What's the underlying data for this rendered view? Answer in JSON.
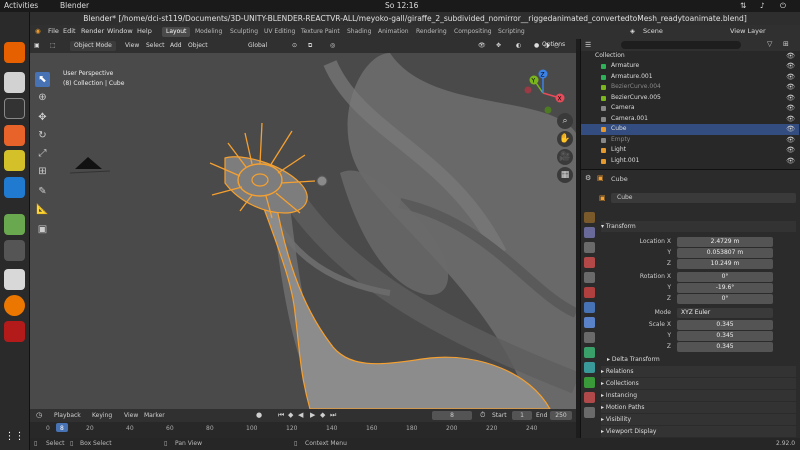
{
  "os_topbar": {
    "activities": "Activities",
    "app": "Blender",
    "clock": "So 12:16"
  },
  "title": "Blender* [/home/dci-st119/Documents/3D-UNITY-BLENDER-REACTVR-ALL/meyoko-gall/giraffe_2_subdivided_nomirror__riggedanimated_convertedtoMesh_readytoanimate.blend]",
  "menu": [
    "File",
    "Edit",
    "Render",
    "Window",
    "Help"
  ],
  "workspaces": [
    "Layout",
    "Modeling",
    "Sculpting",
    "UV Editing",
    "Texture Paint",
    "Shading",
    "Animation",
    "Rendering",
    "Compositing",
    "Scripting"
  ],
  "scene": "Scene",
  "view_layer": "View Layer",
  "viewport_header": {
    "mode": "Object Mode",
    "view": "View",
    "select": "Select",
    "add": "Add",
    "object": "Object",
    "orientation": "Global",
    "options": "Options"
  },
  "viewport": {
    "perspective": "User Perspective",
    "collection": "(8) Collection | Cube"
  },
  "gizmo": {
    "x": "X",
    "y": "Y",
    "z": "Z"
  },
  "outliner": {
    "collection": "Collection",
    "items": [
      {
        "name": "Armature",
        "selected": false,
        "dim": false
      },
      {
        "name": "Armature.001",
        "selected": false,
        "dim": false
      },
      {
        "name": "BezierCurve.004",
        "selected": false,
        "dim": true
      },
      {
        "name": "BezierCurve.005",
        "selected": false,
        "dim": false
      },
      {
        "name": "Camera",
        "selected": false,
        "dim": false
      },
      {
        "name": "Camera.001",
        "selected": false,
        "dim": false
      },
      {
        "name": "Cube",
        "selected": true,
        "dim": false
      },
      {
        "name": "Empty",
        "selected": false,
        "dim": true
      },
      {
        "name": "Light",
        "selected": false,
        "dim": false
      },
      {
        "name": "Light.001",
        "selected": false,
        "dim": false
      }
    ]
  },
  "properties": {
    "object_name": "Cube",
    "object_field": "Cube",
    "transform": "Transform",
    "location_x_label": "Location X",
    "location_x": "2.4729 m",
    "location_y_label": "Y",
    "location_y": "0.053807 m",
    "location_z_label": "Z",
    "location_z": "10.249 m",
    "rotation_x_label": "Rotation X",
    "rotation_x": "0°",
    "rotation_y_label": "Y",
    "rotation_y": "-19.6°",
    "rotation_z_label": "Z",
    "rotation_z": "0°",
    "mode_label": "Mode",
    "mode": "XYZ Euler",
    "scale_x_label": "Scale X",
    "scale_x": "0.345",
    "scale_y_label": "Y",
    "scale_y": "0.345",
    "scale_z_label": "Z",
    "scale_z": "0.345",
    "sections": [
      "Delta Transform",
      "Relations",
      "Collections",
      "Instancing",
      "Motion Paths",
      "Visibility",
      "Viewport Display"
    ]
  },
  "timeline": {
    "playback": "Playback",
    "keying": "Keying",
    "view": "View",
    "marker": "Marker",
    "current_frame": "8",
    "start_label": "Start",
    "start": "1",
    "end_label": "End",
    "end": "250",
    "ticks": [
      "0",
      "20",
      "40",
      "60",
      "80",
      "100",
      "120",
      "140",
      "160",
      "180",
      "200",
      "220",
      "240"
    ]
  },
  "status": {
    "select": "Select",
    "box_select": "Box Select",
    "pan_view": "Pan View",
    "context_menu": "Context Menu",
    "version": "2.92.0"
  },
  "colors": {
    "selection_orange": "#f5a030",
    "accent_blue": "#4772b3",
    "viewport_grey": "#4b4b4b"
  }
}
